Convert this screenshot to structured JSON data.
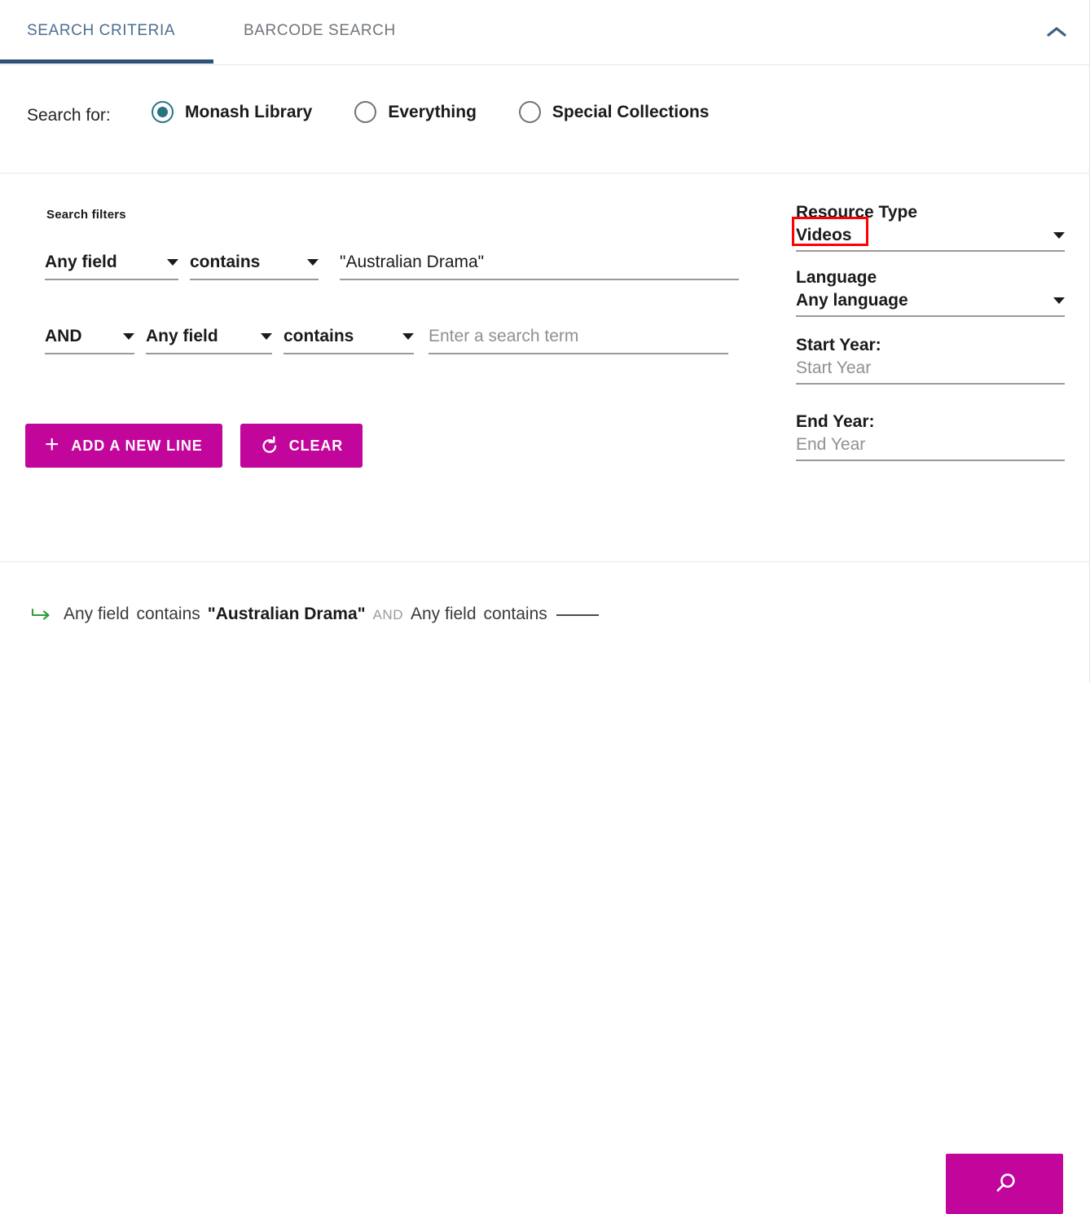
{
  "tabs": [
    {
      "id": "search-criteria",
      "label": "SEARCH CRITERIA",
      "active": true
    },
    {
      "id": "barcode-search",
      "label": "BARCODE SEARCH",
      "active": false
    }
  ],
  "collapse": {
    "icon": "chevron-up-icon"
  },
  "search_for": {
    "label": "Search for:",
    "options": [
      {
        "label": "Monash Library",
        "selected": true
      },
      {
        "label": "Everything",
        "selected": false
      },
      {
        "label": "Special Collections",
        "selected": false
      }
    ]
  },
  "filters": {
    "heading": "Search filters",
    "rows": [
      {
        "field": "Any field",
        "operator": "contains",
        "value": "\"Australian Drama\"",
        "placeholder": "Enter a search term"
      },
      {
        "boolean": "AND",
        "field": "Any field",
        "operator": "contains",
        "value": "",
        "placeholder": "Enter a search term"
      }
    ],
    "add_line_label": "ADD A NEW LINE",
    "add_line_icon": "plus-icon",
    "clear_label": "CLEAR",
    "clear_icon": "reset-arrow-icon"
  },
  "facets": {
    "resource_type": {
      "label": "Resource Type",
      "value": "Videos",
      "highlighted": true
    },
    "language": {
      "label": "Language",
      "value": "Any language"
    },
    "start_year": {
      "label": "Start Year:",
      "value": "",
      "placeholder": "Start Year"
    },
    "end_year": {
      "label": "End Year:",
      "value": "",
      "placeholder": "End Year"
    }
  },
  "summary": {
    "arrow_icon": "enter-arrow-icon",
    "field1": "Any field",
    "operator1": "contains",
    "term1": "\"Australian Drama\"",
    "boolean": "AND",
    "field2": "Any field",
    "operator2": "contains",
    "term2": ""
  },
  "search_button": {
    "icon": "search-icon",
    "label": ""
  },
  "colors": {
    "accent_magenta": "#c2059b",
    "tab_active": "#4d6e8e",
    "tab_underline": "#2c5277",
    "radio_selected": "#2a7282",
    "highlight_red": "#ff0000",
    "arrow_green": "#2e9c3c"
  }
}
